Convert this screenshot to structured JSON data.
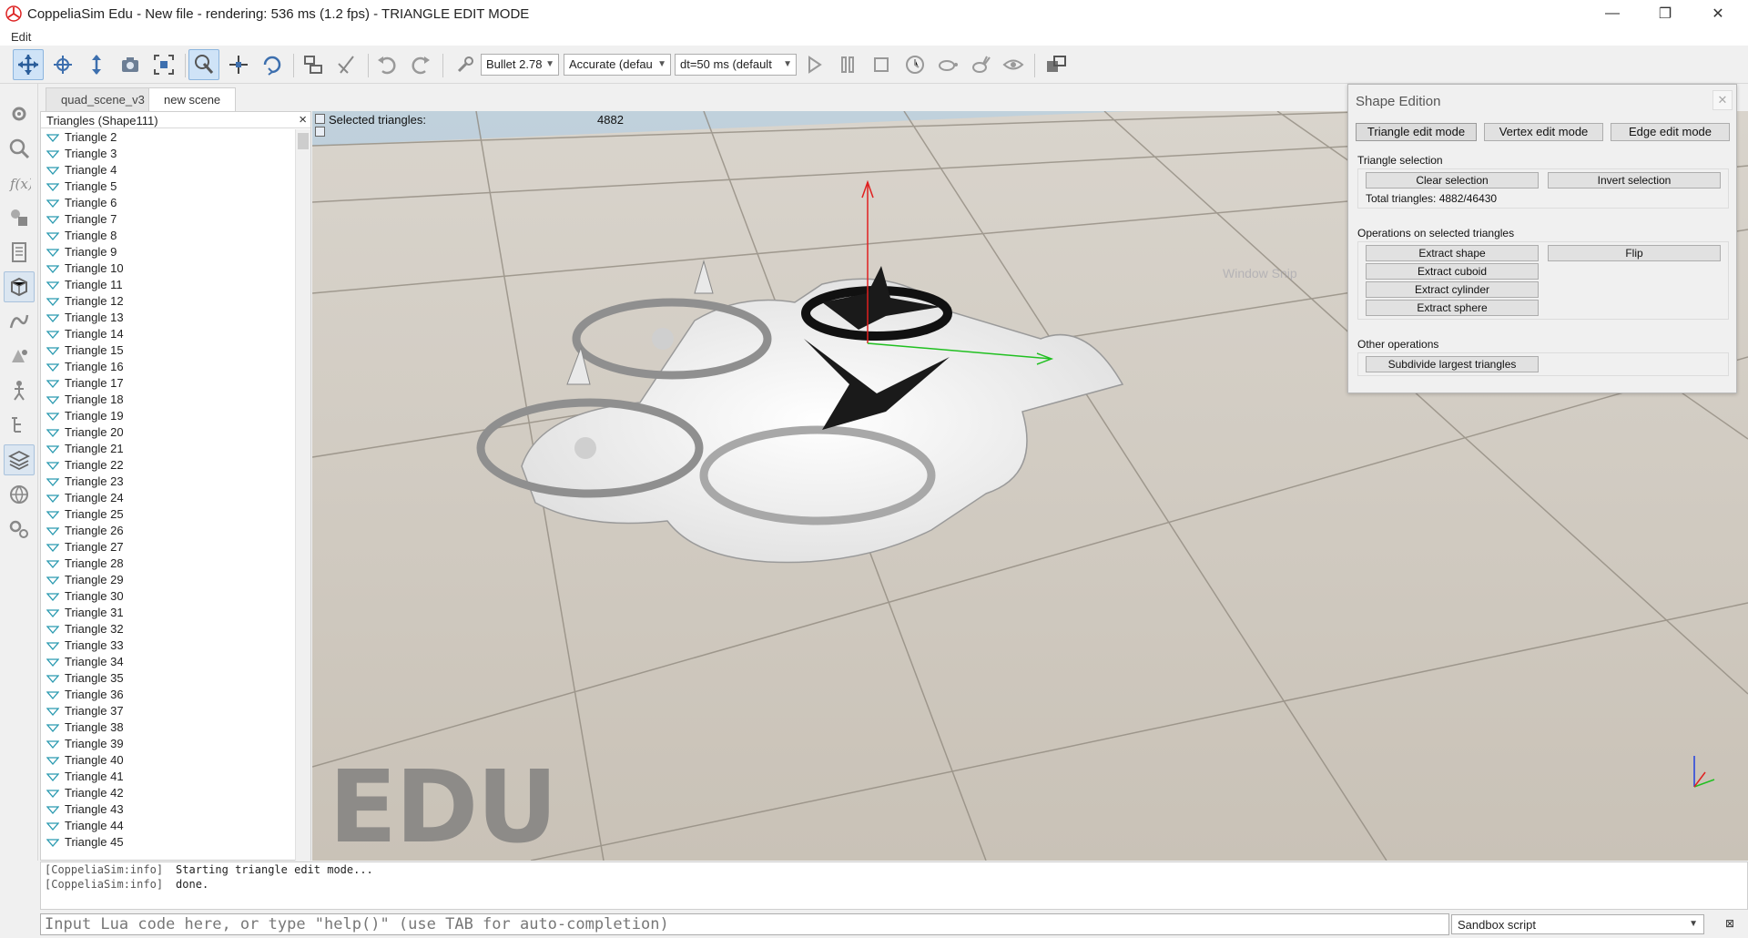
{
  "window": {
    "title": "CoppeliaSim Edu - New file - rendering: 536 ms (1.2 fps) - TRIANGLE EDIT MODE",
    "minimize": "—",
    "restore": "❐",
    "close": "✕"
  },
  "menu": {
    "items": [
      "Edit"
    ]
  },
  "toolbar": {
    "engine": "Bullet 2.78",
    "accuracy": "Accurate (defau",
    "timestep": "dt=50 ms (default"
  },
  "tabs": [
    {
      "label": "quad_scene_v3",
      "active": false
    },
    {
      "label": "new scene",
      "active": true
    }
  ],
  "hierarchy": {
    "title": "Triangles (Shape111)",
    "items": [
      "Triangle 2",
      "Triangle 3",
      "Triangle 4",
      "Triangle 5",
      "Triangle 6",
      "Triangle 7",
      "Triangle 8",
      "Triangle 9",
      "Triangle 10",
      "Triangle 11",
      "Triangle 12",
      "Triangle 13",
      "Triangle 14",
      "Triangle 15",
      "Triangle 16",
      "Triangle 17",
      "Triangle 18",
      "Triangle 19",
      "Triangle 20",
      "Triangle 21",
      "Triangle 22",
      "Triangle 23",
      "Triangle 24",
      "Triangle 25",
      "Triangle 26",
      "Triangle 27",
      "Triangle 28",
      "Triangle 29",
      "Triangle 30",
      "Triangle 31",
      "Triangle 32",
      "Triangle 33",
      "Triangle 34",
      "Triangle 35",
      "Triangle 36",
      "Triangle 37",
      "Triangle 38",
      "Triangle 39",
      "Triangle 40",
      "Triangle 41",
      "Triangle 42",
      "Triangle 43",
      "Triangle 44",
      "Triangle 45"
    ]
  },
  "viewport": {
    "selected_label": "Selected triangles:",
    "selected_value": "4882",
    "watermark": "EDU",
    "ghost_text": "Window Snip"
  },
  "shape_edition": {
    "title": "Shape Edition",
    "modes": [
      "Triangle edit mode",
      "Vertex edit mode",
      "Edge edit mode"
    ],
    "triangle_selection_label": "Triangle selection",
    "clear_selection": "Clear selection",
    "invert_selection": "Invert selection",
    "total_triangles": "Total triangles: 4882/46430",
    "operations_label": "Operations on selected triangles",
    "extract_shape": "Extract shape",
    "flip": "Flip",
    "extract_cuboid": "Extract cuboid",
    "extract_cylinder": "Extract cylinder",
    "extract_sphere": "Extract sphere",
    "other_label": "Other operations",
    "subdivide": "Subdivide largest triangles"
  },
  "console": {
    "lines": [
      {
        "tag": "[CoppeliaSim:info]",
        "msg": "Starting triangle edit mode..."
      },
      {
        "tag": "[CoppeliaSim:info]",
        "msg": "done."
      }
    ]
  },
  "cmdline": {
    "placeholder": "Input Lua code here, or type \"help()\" (use TAB for auto-completion)",
    "script": "Sandbox script"
  },
  "colors": {
    "accent": "#cfe3f7",
    "x_axis": "#e02020",
    "y_axis": "#20c020",
    "z_axis": "#2040e0"
  }
}
